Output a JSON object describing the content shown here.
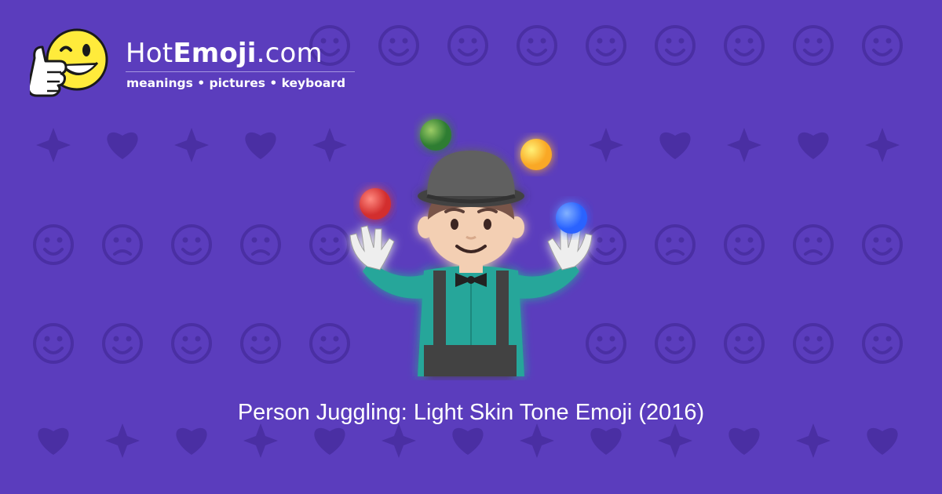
{
  "brand": {
    "prefix": "Hot",
    "bold": "Emoji",
    "suffix": ".com"
  },
  "tagline": "meanings • pictures • keyboard",
  "caption": "Person Juggling: Light Skin Tone Emoji (2016)",
  "colors": {
    "background": "#5b3dbd",
    "pattern": "#4a2fa3",
    "smiley": "#ffeb3b",
    "shirt": "#26a69a",
    "ball_red": "#e53935",
    "ball_green": "#43a047",
    "ball_yellow": "#fbc02d",
    "ball_blue": "#2979ff"
  },
  "icons": [
    "thumbs-up-smiley-logo-icon",
    "person-juggling-icon",
    "emoji-pattern-background"
  ]
}
